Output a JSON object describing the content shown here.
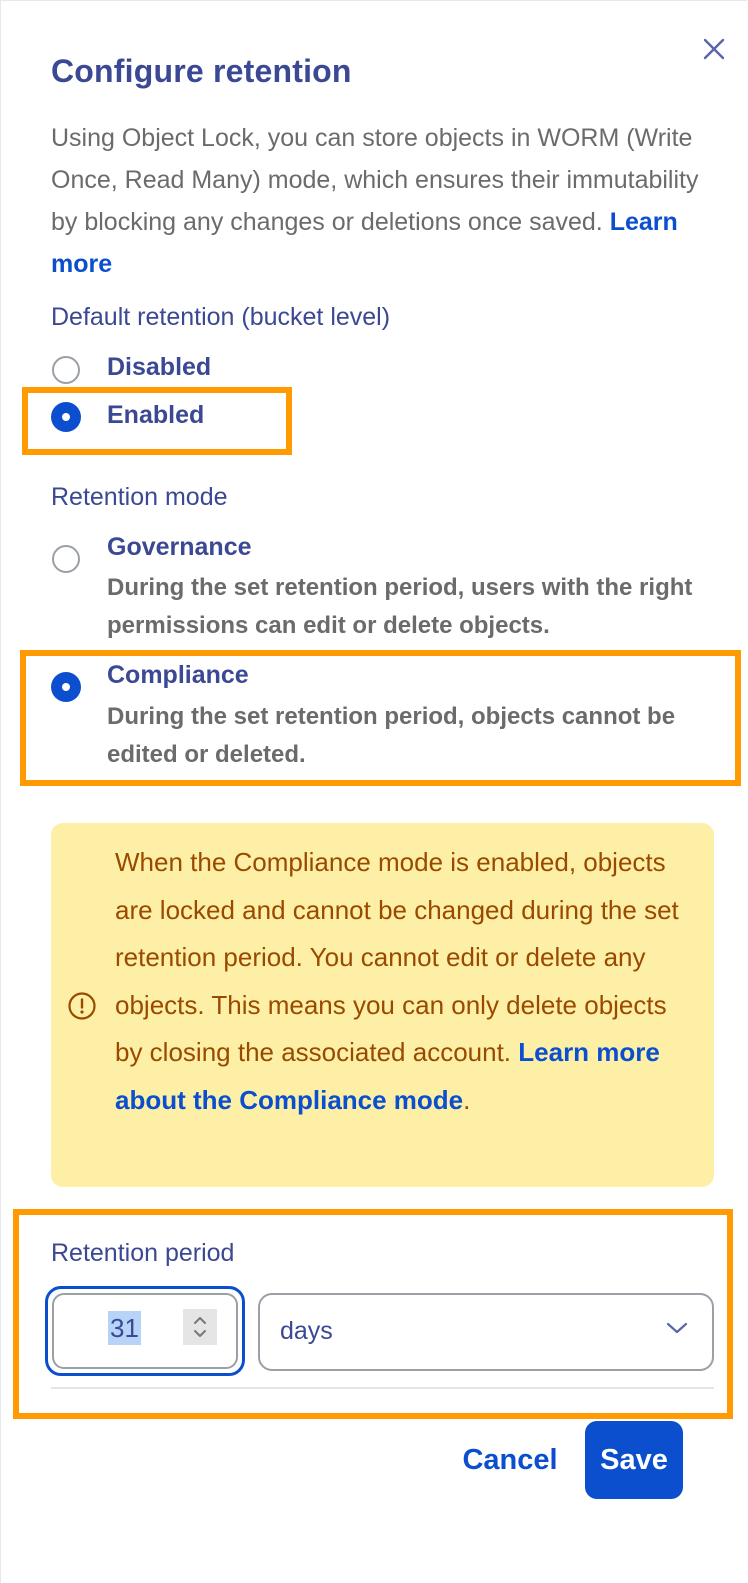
{
  "dialog": {
    "title": "Configure retention",
    "intro_text": "Using Object Lock, you can store objects in WORM (Write Once, Read Many) mode, which ensures their immutability by blocking any changes or deletions once saved.",
    "intro_link": "Learn more"
  },
  "default_retention": {
    "label": "Default retention (bucket level)",
    "options": [
      {
        "label": "Disabled",
        "checked": false
      },
      {
        "label": "Enabled",
        "checked": true
      }
    ]
  },
  "retention_mode": {
    "label": "Retention mode",
    "options": [
      {
        "label": "Governance",
        "description": "During the set retention period, users with the right permissions can edit or delete objects.",
        "checked": false
      },
      {
        "label": "Compliance",
        "description": "During the set retention period, objects cannot be edited or deleted.",
        "checked": true
      }
    ]
  },
  "alert": {
    "icon": "info-circle-icon",
    "text": "When the Compliance mode is enabled, objects are locked and cannot be changed during the set retention period. You cannot edit or delete any objects. This means you can only delete objects by closing the associated account.",
    "link": "Learn more about the Compliance mode",
    "trailing": "."
  },
  "retention_period": {
    "label": "Retention period",
    "value": "31",
    "unit": "days"
  },
  "actions": {
    "cancel": "Cancel",
    "save": "Save"
  },
  "colors": {
    "accent": "#0b4fcf",
    "heading": "#3b4893",
    "highlight": "#ff9a00",
    "alert_bg": "#fdf0a6",
    "alert_text": "#9a4a00"
  }
}
